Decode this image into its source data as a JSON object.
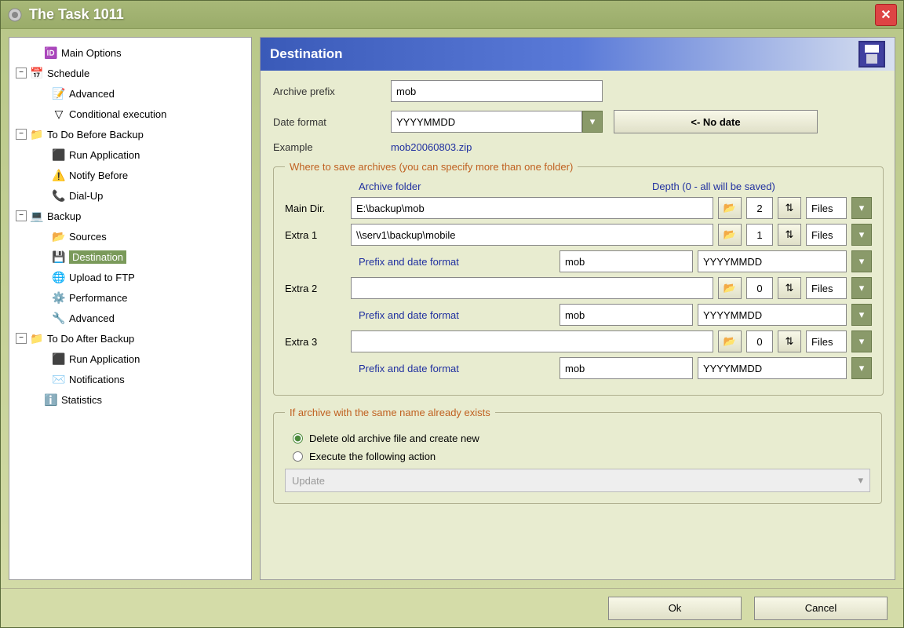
{
  "window": {
    "title": "The Task 1011"
  },
  "tree": [
    {
      "label": "Main Options",
      "indent": 1,
      "icon": "🆔",
      "iconName": "id-icon"
    },
    {
      "label": "Schedule",
      "indent": 0,
      "toggle": "-",
      "icon": "📅",
      "iconName": "schedule-icon"
    },
    {
      "label": "Advanced",
      "indent": 2,
      "icon": "📝",
      "iconName": "advanced-icon"
    },
    {
      "label": "Conditional execution",
      "indent": 2,
      "icon": "▽",
      "iconName": "funnel-icon"
    },
    {
      "label": "To Do Before Backup",
      "indent": 0,
      "toggle": "-",
      "icon": "📁",
      "iconName": "folder-icon"
    },
    {
      "label": "Run Application",
      "indent": 2,
      "icon": "⬛",
      "iconName": "console-icon"
    },
    {
      "label": "Notify Before",
      "indent": 2,
      "icon": "⚠️",
      "iconName": "warning-icon"
    },
    {
      "label": "Dial-Up",
      "indent": 2,
      "icon": "📞",
      "iconName": "dialup-icon"
    },
    {
      "label": "Backup",
      "indent": 0,
      "toggle": "-",
      "icon": "💻",
      "iconName": "backup-icon"
    },
    {
      "label": "Sources",
      "indent": 2,
      "icon": "📂",
      "iconName": "sources-icon"
    },
    {
      "label": "Destination",
      "indent": 2,
      "icon": "💾",
      "iconName": "floppy-icon",
      "selected": true
    },
    {
      "label": "Upload to FTP",
      "indent": 2,
      "icon": "🌐",
      "iconName": "ftp-icon"
    },
    {
      "label": "Performance",
      "indent": 2,
      "icon": "⚙️",
      "iconName": "performance-icon"
    },
    {
      "label": "Advanced",
      "indent": 2,
      "icon": "🔧",
      "iconName": "advanced2-icon"
    },
    {
      "label": "To Do After Backup",
      "indent": 0,
      "toggle": "-",
      "icon": "📁",
      "iconName": "folder-icon"
    },
    {
      "label": "Run Application",
      "indent": 2,
      "icon": "⬛",
      "iconName": "console-icon"
    },
    {
      "label": "Notifications",
      "indent": 2,
      "icon": "✉️",
      "iconName": "mail-icon"
    },
    {
      "label": "Statistics",
      "indent": 1,
      "icon": "ℹ️",
      "iconName": "info-icon"
    }
  ],
  "panel": {
    "title": "Destination",
    "labels": {
      "archive_prefix": "Archive prefix",
      "date_format": "Date format",
      "example": "Example",
      "no_date_btn": "<- No date",
      "fieldset_where": "Where to save archives (you can specify more than one folder)",
      "col_archive_folder": "Archive folder",
      "col_depth": "Depth (0 - all will be saved)",
      "main_dir": "Main Dir.",
      "extra1": "Extra 1",
      "extra2": "Extra 2",
      "extra3": "Extra 3",
      "prefix_date_format": "Prefix and date format",
      "files": "Files",
      "fieldset_exists": "If archive with the same name already exists",
      "radio_delete": "Delete old archive file and create new",
      "radio_execute": "Execute the following action",
      "action_select": "Update"
    },
    "values": {
      "archive_prefix": "mob",
      "date_format": "YYYYMMDD",
      "example": "mob20060803.zip",
      "dirs": [
        {
          "path": "E:\\backup\\mob",
          "depth": "2",
          "unit": "Files",
          "prefix": "",
          "dfmt": ""
        },
        {
          "path": "\\\\serv1\\backup\\mobile",
          "depth": "1",
          "unit": "Files",
          "prefix": "mob",
          "dfmt": "YYYYMMDD"
        },
        {
          "path": "",
          "depth": "0",
          "unit": "Files",
          "prefix": "mob",
          "dfmt": "YYYYMMDD"
        },
        {
          "path": "",
          "depth": "0",
          "unit": "Files",
          "prefix": "mob",
          "dfmt": "YYYYMMDD"
        }
      ],
      "exists_option": "delete"
    }
  },
  "footer": {
    "ok": "Ok",
    "cancel": "Cancel"
  }
}
